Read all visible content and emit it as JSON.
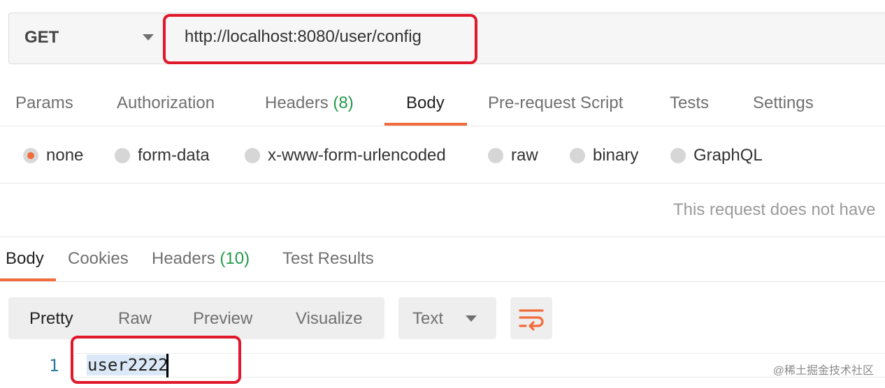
{
  "request": {
    "method": "GET",
    "url": "http://localhost:8080/user/config"
  },
  "request_tabs": {
    "params": "Params",
    "authorization": "Authorization",
    "headers_label": "Headers",
    "headers_count": "(8)",
    "body": "Body",
    "prerequest": "Pre-request Script",
    "tests": "Tests",
    "settings": "Settings",
    "active": "Body"
  },
  "body_types": {
    "none": "none",
    "form_data": "form-data",
    "urlencoded": "x-www-form-urlencoded",
    "raw": "raw",
    "binary": "binary",
    "graphql": "GraphQL",
    "selected": "none"
  },
  "empty_body_message": "This request does not have",
  "response_tabs": {
    "body": "Body",
    "cookies": "Cookies",
    "headers_label": "Headers",
    "headers_count": "(10)",
    "test_results": "Test Results",
    "active": "Body"
  },
  "view_modes": {
    "pretty": "Pretty",
    "raw": "Raw",
    "preview": "Preview",
    "visualize": "Visualize",
    "active": "Pretty"
  },
  "format_select": {
    "value": "Text"
  },
  "response_body": {
    "line_number": "1",
    "text": "user2222"
  },
  "watermark": "@稀土掘金技术社区",
  "colors": {
    "accent": "#f26b3a",
    "count_green": "#259a4a",
    "highlight_box": "#e0182c"
  },
  "icons": {
    "method_dropdown": "chevron-down-icon",
    "format_dropdown": "chevron-down-icon",
    "wrap": "wrap-lines-icon"
  }
}
